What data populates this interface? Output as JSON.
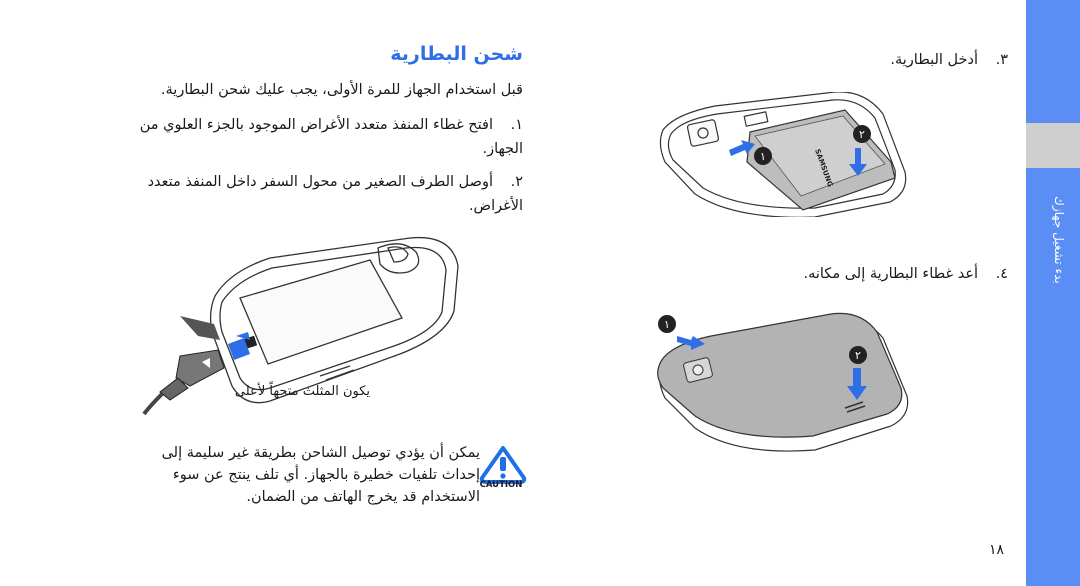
{
  "side_tab": {
    "label": "بدء تشغيل جهازك",
    "color": "#5b8ef5"
  },
  "section": {
    "title": "شحن البطارية",
    "title_color": "#2f6ee8",
    "intro": "قبل استخدام الجهاز للمرة الأولى، يجب عليك شحن البطارية."
  },
  "steps": [
    {
      "number": "١.",
      "text": "افتح غطاء المنفذ متعدد الأغراض الموجود بالجزء العلوي من الجهاز."
    },
    {
      "number": "٢.",
      "text": "أوصل الطرف الصغير من محول السفر داخل المنفذ متعدد الأغراض."
    },
    {
      "number": "٣.",
      "text": "أدخل البطارية."
    },
    {
      "number": "٤.",
      "text": "أعد غطاء البطارية إلى مكانه."
    }
  ],
  "illustrations": {
    "charger_caption": "يكون المثلث متجهاً لأعلى",
    "battery_insert_badges": [
      "١",
      "٢"
    ],
    "battery_cover_badges": [
      "١",
      "٢"
    ],
    "battery_brand": "SAMSUNG",
    "arrow_color": "#2e6ee6"
  },
  "caution": {
    "icon": "caution-warning-icon",
    "label": "CAUTION",
    "text": "يمكن أن يؤدي توصيل الشاحن بطريقة غير سليمة إلى إحداث تلفيات خطيرة بالجهاز. أي تلف ينتج عن سوء الاستخدام قد يخرج الهاتف من الضمان."
  },
  "page_number": "١٨"
}
